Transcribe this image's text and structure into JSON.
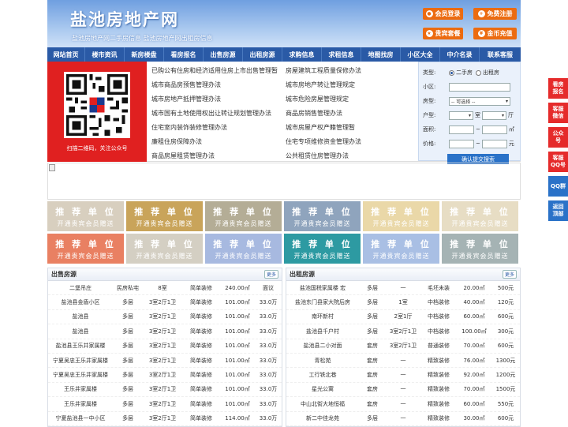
{
  "header": {
    "title": "盐池房地产网",
    "subtitle": "盐池房地产网二手房信息   盐池房地产网出租房信息",
    "buttons": [
      {
        "label": "会员登录",
        "icon": "user-icon"
      },
      {
        "label": "免费注册",
        "icon": "register-icon"
      },
      {
        "label": "贵宾套餐",
        "icon": "vip-icon"
      },
      {
        "label": "金币充值",
        "icon": "coin-icon"
      }
    ]
  },
  "nav": [
    "网站首页",
    "楼市资讯",
    "新房楼盘",
    "看房报名",
    "出售房源",
    "出租房源",
    "求购信息",
    "求租信息",
    "地图找房",
    "小区大全",
    "中介名录",
    "联系客服"
  ],
  "qr": {
    "caption": "扫描二维码，关注公众号"
  },
  "links": [
    "已购公有住房和经济适用住房上市出售管理暂",
    "房屋建筑工程质量保修办法",
    "城市商品房预售管理办法",
    "城市房地产转让管理规定",
    "城市房地产抵押管理办法",
    "城市危险房屋管理规定",
    "城市国有土地使用权出让转让规划管理办法",
    "商品房销售管理办法",
    "住宅室内装饰装修管理办法",
    "城市房屋产权产籍管理暂",
    "廉租住房保障办法",
    "住宅专项维修资金管理办法",
    "商品房屋租赁管理办法",
    "公共租赁住房管理办法"
  ],
  "search": {
    "type_label": "类型:",
    "type_options": [
      "二手房",
      "出租房"
    ],
    "community_label": "小区:",
    "house_label": "房型:",
    "house_select": "-- 可选择 --",
    "layout_label": "户型:",
    "room_unit": "室",
    "hall_unit": "厅",
    "area_label": "面积:",
    "area_unit": "㎡",
    "price_label": "价格:",
    "price_unit": "元",
    "submit": "确认提交搜索"
  },
  "ads": {
    "line1": "推 荐 单 位",
    "line2": "开通贵宾会员赠送",
    "colors": [
      "#d8cfbf",
      "#c9a45a",
      "#b4ad96",
      "#8fa4bd",
      "#ead8a8",
      "#e7ddc4",
      "#e98062",
      "#d4cfc3",
      "#a7b9e0",
      "#2d9aa2",
      "#a9bfe4",
      "#a5b3b4"
    ]
  },
  "sale": {
    "title": "出售房源",
    "more": "更多",
    "rows": [
      [
        "二堡吊庄",
        "民房私宅",
        "8室",
        "简单装修",
        "240.00㎡",
        "面议"
      ],
      [
        "盐池县金盾小区",
        "多层",
        "3室2厅1卫",
        "简单装修",
        "101.00㎡",
        "33.0万"
      ],
      [
        "盐池县",
        "多层",
        "3室2厅1卫",
        "简单装修",
        "101.00㎡",
        "33.0万"
      ],
      [
        "盐池县",
        "多层",
        "3室2厅1卫",
        "简单装修",
        "101.00㎡",
        "33.0万"
      ],
      [
        "盐池县王乐井家属楼",
        "多层",
        "3室2厅1卫",
        "简单装修",
        "101.00㎡",
        "33.0万"
      ],
      [
        "宁夏吴忠王乐井家属楼",
        "多层",
        "3室2厅1卫",
        "简单装修",
        "101.00㎡",
        "33.0万"
      ],
      [
        "宁夏吴忠王乐井家属楼",
        "多层",
        "3室2厅1卫",
        "简单装修",
        "101.00㎡",
        "33.0万"
      ],
      [
        "王乐井家属楼",
        "多层",
        "3室2厅1卫",
        "简单装修",
        "101.00㎡",
        "33.0万"
      ],
      [
        "王乐井家属楼",
        "多层",
        "3室2厅1卫",
        "简单装修",
        "101.00㎡",
        "33.0万"
      ],
      [
        "宁夏盐池县一中小区",
        "多层",
        "3室2厅1卫",
        "简单装修",
        "114.00㎡",
        "33.0万"
      ]
    ]
  },
  "rent": {
    "title": "出租房源",
    "more": "更多",
    "rows": [
      [
        "盐池国税家属楼 宏",
        "多层",
        "一",
        "毛坯未装",
        "20.00㎡",
        "500元"
      ],
      [
        "盐池东门县家大院后房",
        "多层",
        "1室",
        "中档装修",
        "40.00㎡",
        "120元"
      ],
      [
        "南环新村",
        "多层",
        "2室1厅",
        "中档装修",
        "60.00㎡",
        "600元"
      ],
      [
        "盐池县千户村",
        "多层",
        "3室2厅1卫",
        "中档装修",
        "100.00㎡",
        "300元"
      ],
      [
        "盐池县二小对面",
        "套房",
        "3室2厅1卫",
        "普通装修",
        "70.00㎡",
        "600元"
      ],
      [
        "青松苑",
        "套房",
        "一",
        "精致装修",
        "76.00㎡",
        "1300元"
      ],
      [
        "工行铁北巷",
        "套房",
        "一",
        "精致装修",
        "92.00㎡",
        "1200元"
      ],
      [
        "星光公寓",
        "套房",
        "一",
        "精致装修",
        "70.00㎡",
        "1500元"
      ],
      [
        "中山北街大地恒福",
        "套房",
        "一",
        "精致装修",
        "60.00㎡",
        "550元"
      ],
      [
        "新二中佳龙苑",
        "多层",
        "一",
        "精致装修",
        "30.00㎡",
        "600元"
      ]
    ]
  },
  "float": [
    "看房报名",
    "客服微信",
    "公众号",
    "客服QQ号",
    "QQ群",
    "返回顶部"
  ]
}
